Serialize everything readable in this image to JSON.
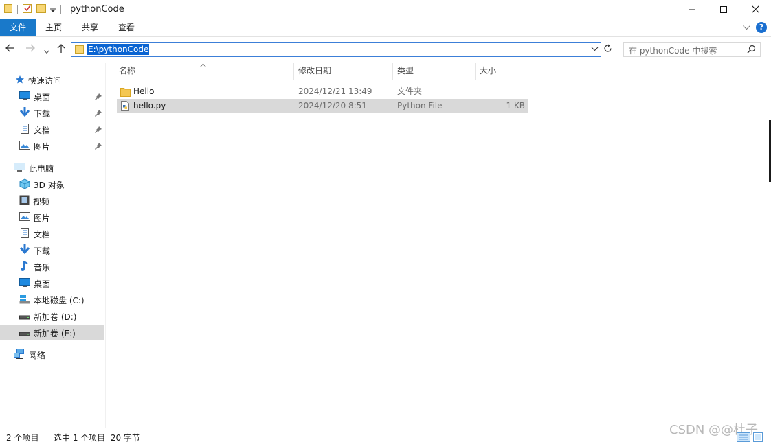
{
  "window": {
    "title": "pythonCode"
  },
  "ribbon": {
    "tabs": [
      "文件",
      "主页",
      "共享",
      "查看"
    ]
  },
  "address": {
    "path": "E:\\pythonCode"
  },
  "search": {
    "placeholder": "在 pythonCode 中搜索"
  },
  "sidebar": {
    "quick_access": "快速访问",
    "quick_items": [
      "桌面",
      "下载",
      "文档",
      "图片"
    ],
    "this_pc": "此电脑",
    "pc_items": [
      "3D 对象",
      "视频",
      "图片",
      "文档",
      "下载",
      "音乐",
      "桌面",
      "本地磁盘 (C:)",
      "新加卷 (D:)",
      "新加卷 (E:)"
    ],
    "network": "网络"
  },
  "columns": {
    "name": "名称",
    "date": "修改日期",
    "type": "类型",
    "size": "大小"
  },
  "files": [
    {
      "name": "Hello",
      "date": "2024/12/21 13:49",
      "type": "文件夹",
      "size": ""
    },
    {
      "name": "hello.py",
      "date": "2024/12/20 8:51",
      "type": "Python File",
      "size": "1 KB"
    }
  ],
  "status": {
    "count": "2 个项目",
    "selection": "选中 1 个项目  20 字节"
  },
  "watermark": "CSDN @@杜子",
  "colors": {
    "accent": "#1979ca",
    "selection": "#d9d9d9",
    "folder": "#f4c752"
  }
}
